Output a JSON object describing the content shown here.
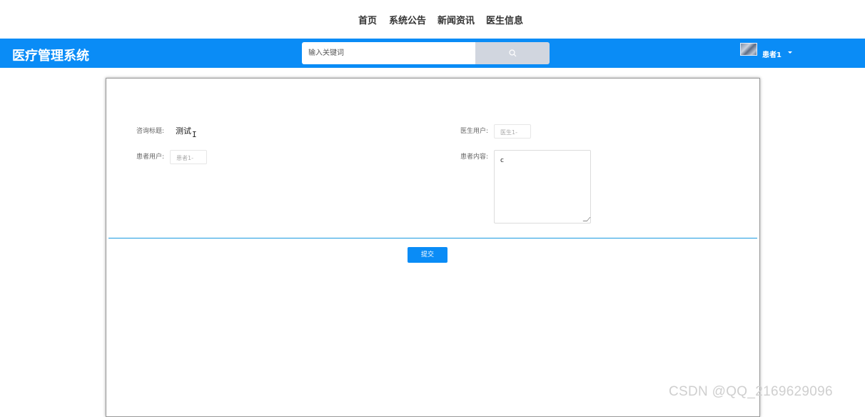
{
  "top_nav": {
    "items": [
      {
        "label": "首页"
      },
      {
        "label": "系统公告"
      },
      {
        "label": "新闻资讯"
      },
      {
        "label": "医生信息"
      }
    ]
  },
  "header": {
    "brand": "医疗管理系统",
    "search": {
      "placeholder": "输入关键词",
      "value": ""
    },
    "search_icon": "search-icon",
    "user": {
      "name": "患者1",
      "avatar_icon": "avatar-image",
      "menu_icon": "caret-down-icon"
    },
    "bg_color": "#0a8cf6"
  },
  "form": {
    "title_label": "咨询标题:",
    "title_value": "测试",
    "doctor_label": "医生用户:",
    "doctor_value": "医生1-",
    "patient_label": "患者用户:",
    "patient_value": "患者1-",
    "content_label": "患者内容:",
    "content_value": "c",
    "submit_label": "提交"
  },
  "watermark": "CSDN @QQ_2169629096"
}
